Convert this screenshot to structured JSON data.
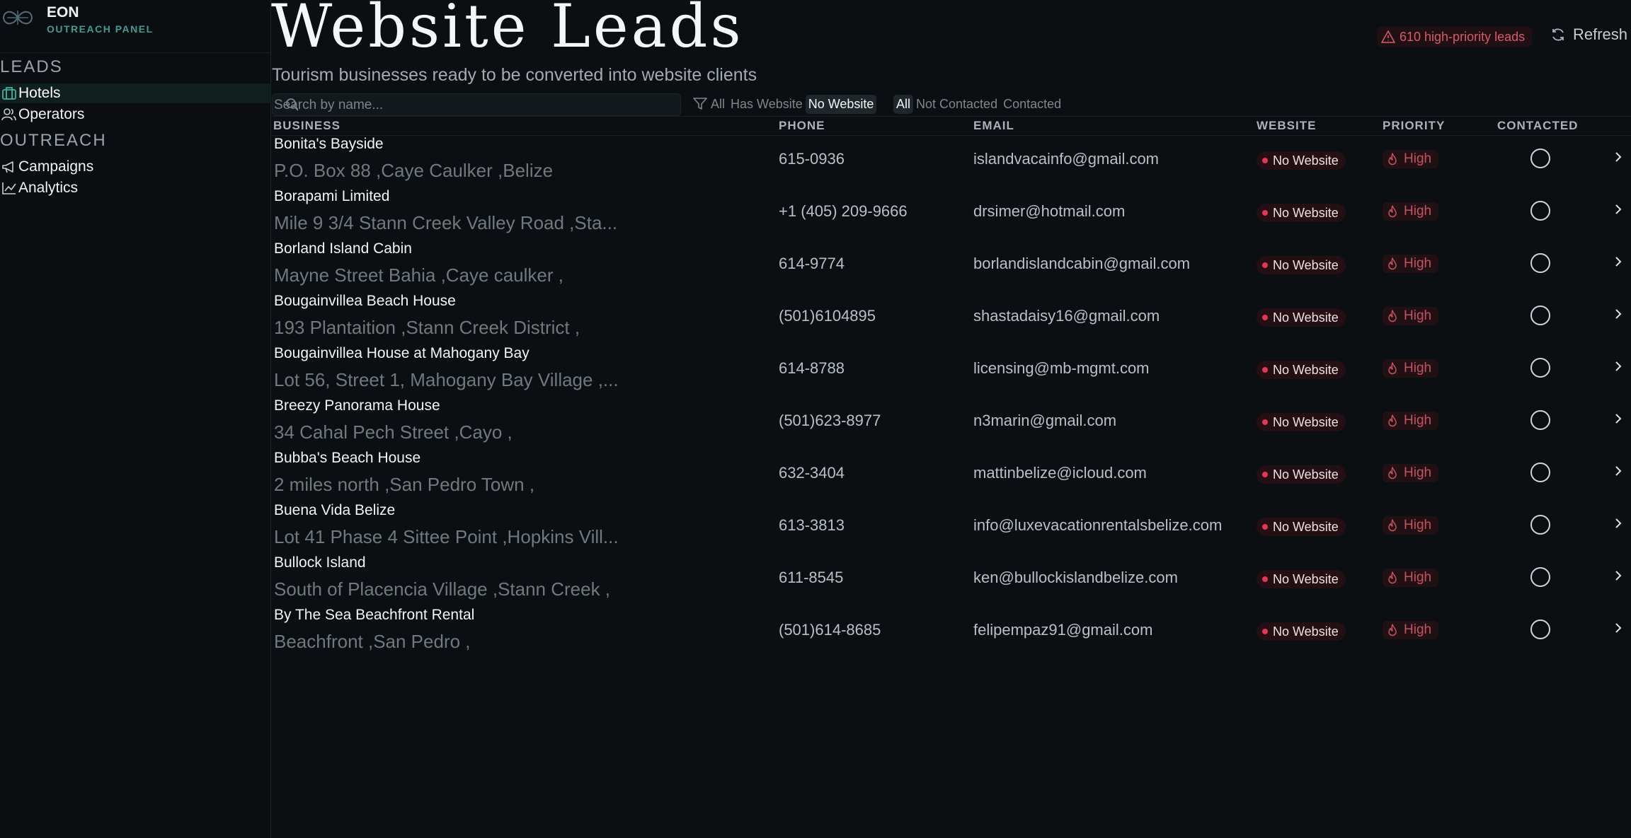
{
  "brand": {
    "title": "EON",
    "subtitle": "OUTREACH PANEL"
  },
  "sidebar": {
    "sections": [
      {
        "label": "LEADS",
        "items": [
          {
            "label": "Hotels",
            "icon": "luggage-icon",
            "active": true
          },
          {
            "label": "Operators",
            "icon": "users-icon",
            "active": false
          }
        ]
      },
      {
        "label": "OUTREACH",
        "items": [
          {
            "label": "Campaigns",
            "icon": "megaphone-icon",
            "active": false
          },
          {
            "label": "Analytics",
            "icon": "chart-line-icon",
            "active": false
          }
        ]
      }
    ]
  },
  "header": {
    "title": "Website Leads",
    "subtitle": "Tourism businesses ready to be converted into website clients",
    "alert": "610 high-priority leads",
    "refresh_label": "Refresh"
  },
  "search": {
    "placeholder": "Search by name...",
    "value": ""
  },
  "filters": {
    "website": {
      "options": [
        "All",
        "Has Website",
        "No Website"
      ],
      "selected": "No Website"
    },
    "contact": {
      "options": [
        "All",
        "Not Contacted",
        "Contacted"
      ],
      "selected": "All"
    }
  },
  "table": {
    "columns": [
      "BUSINESS",
      "PHONE",
      "EMAIL",
      "WEBSITE",
      "PRIORITY",
      "CONTACTED"
    ],
    "rows": [
      {
        "name": "Bonita's Bayside",
        "address": "P.O. Box 88 ,Caye Caulker ,Belize",
        "phone": "615-0936",
        "email": "islandvacainfo@gmail.com",
        "website": "No Website",
        "priority": "High"
      },
      {
        "name": "Borapami Limited",
        "address": "Mile 9 3/4 Stann Creek Valley Road ,Sta...",
        "phone": "+1 (405) 209-9666",
        "email": "drsimer@hotmail.com",
        "website": "No Website",
        "priority": "High"
      },
      {
        "name": "Borland Island Cabin",
        "address": "Mayne Street Bahia ,Caye caulker ,",
        "phone": "614-9774",
        "email": "borlandislandcabin@gmail.com",
        "website": "No Website",
        "priority": "High"
      },
      {
        "name": "Bougainvillea Beach House",
        "address": "193 Plantaition ,Stann Creek District ,",
        "phone": "(501)6104895",
        "email": "shastadaisy16@gmail.com",
        "website": "No Website",
        "priority": "High"
      },
      {
        "name": "Bougainvillea House at Mahogany Bay",
        "address": "Lot 56, Street 1, Mahogany Bay Village ,...",
        "phone": "614-8788",
        "email": "licensing@mb-mgmt.com",
        "website": "No Website",
        "priority": "High"
      },
      {
        "name": "Breezy Panorama House",
        "address": "34 Cahal Pech Street ,Cayo ,",
        "phone": "(501)623-8977",
        "email": "n3marin@gmail.com",
        "website": "No Website",
        "priority": "High"
      },
      {
        "name": "Bubba's Beach House",
        "address": "2 miles north ,San Pedro Town ,",
        "phone": "632-3404",
        "email": "mattinbelize@icloud.com",
        "website": "No Website",
        "priority": "High"
      },
      {
        "name": "Buena Vida Belize",
        "address": "Lot 41 Phase 4 Sittee Point ,Hopkins Vill...",
        "phone": "613-3813",
        "email": "info@luxevacationrentalsbelize.com",
        "website": "No Website",
        "priority": "High"
      },
      {
        "name": "Bullock Island",
        "address": "South of Placencia Village ,Stann Creek ,",
        "phone": "611-8545",
        "email": "ken@bullockislandbelize.com",
        "website": "No Website",
        "priority": "High"
      },
      {
        "name": "By The Sea Beachfront Rental",
        "address": "Beachfront ,San Pedro ,",
        "phone": "(501)614-8685",
        "email": "felipempaz91@gmail.com",
        "website": "No Website",
        "priority": "High"
      }
    ]
  },
  "colors": {
    "accent": "#3f9d93",
    "danger": "#e83554",
    "background": "#0b0f12"
  }
}
